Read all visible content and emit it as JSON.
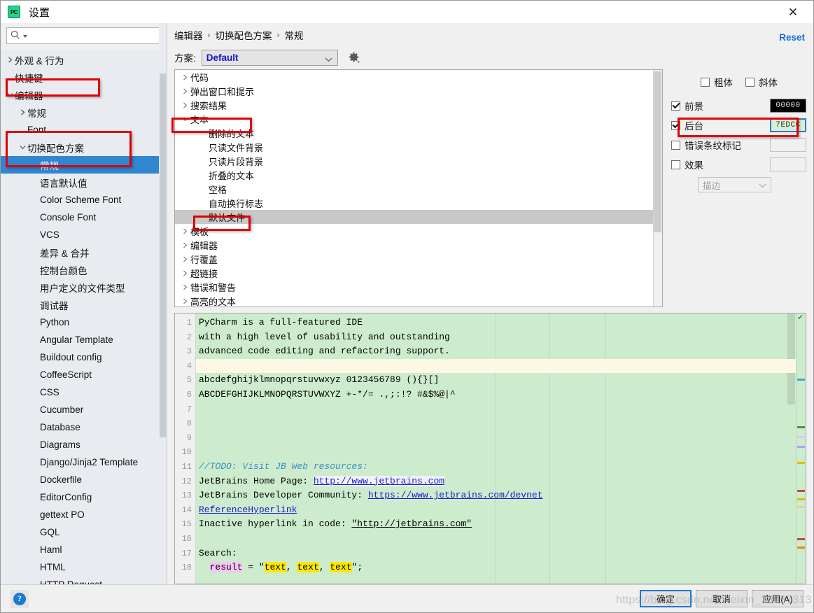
{
  "window": {
    "title": "设置",
    "app_icon": "pycharm-icon",
    "close_icon": "close-icon"
  },
  "sidebar": {
    "search": {
      "placeholder": "",
      "value": "",
      "icon": "search-icon"
    },
    "items": [
      {
        "label": "外观 & 行为",
        "indent": 0,
        "arrow": "right",
        "selected": false
      },
      {
        "label": "快捷键",
        "indent": 0,
        "arrow": "none",
        "selected": false
      },
      {
        "label": "编辑器",
        "indent": 0,
        "arrow": "down",
        "selected": false
      },
      {
        "label": "常规",
        "indent": 1,
        "arrow": "right",
        "selected": false
      },
      {
        "label": "Font",
        "indent": 1,
        "arrow": "none",
        "selected": false
      },
      {
        "label": "切换配色方案",
        "indent": 1,
        "arrow": "down",
        "selected": false
      },
      {
        "label": "常规",
        "indent": 2,
        "arrow": "none",
        "selected": true
      },
      {
        "label": "语言默认值",
        "indent": 2,
        "arrow": "none",
        "selected": false
      },
      {
        "label": "Color Scheme Font",
        "indent": 2,
        "arrow": "none",
        "selected": false
      },
      {
        "label": "Console Font",
        "indent": 2,
        "arrow": "none",
        "selected": false
      },
      {
        "label": "VCS",
        "indent": 2,
        "arrow": "none",
        "selected": false
      },
      {
        "label": "差异 & 合并",
        "indent": 2,
        "arrow": "none",
        "selected": false
      },
      {
        "label": "控制台颜色",
        "indent": 2,
        "arrow": "none",
        "selected": false
      },
      {
        "label": "用户定义的文件类型",
        "indent": 2,
        "arrow": "none",
        "selected": false
      },
      {
        "label": "调试器",
        "indent": 2,
        "arrow": "none",
        "selected": false
      },
      {
        "label": "Python",
        "indent": 2,
        "arrow": "none",
        "selected": false
      },
      {
        "label": "Angular Template",
        "indent": 2,
        "arrow": "none",
        "selected": false
      },
      {
        "label": "Buildout config",
        "indent": 2,
        "arrow": "none",
        "selected": false
      },
      {
        "label": "CoffeeScript",
        "indent": 2,
        "arrow": "none",
        "selected": false
      },
      {
        "label": "CSS",
        "indent": 2,
        "arrow": "none",
        "selected": false
      },
      {
        "label": "Cucumber",
        "indent": 2,
        "arrow": "none",
        "selected": false
      },
      {
        "label": "Database",
        "indent": 2,
        "arrow": "none",
        "selected": false
      },
      {
        "label": "Diagrams",
        "indent": 2,
        "arrow": "none",
        "selected": false
      },
      {
        "label": "Django/Jinja2 Template",
        "indent": 2,
        "arrow": "none",
        "selected": false
      },
      {
        "label": "Dockerfile",
        "indent": 2,
        "arrow": "none",
        "selected": false
      },
      {
        "label": "EditorConfig",
        "indent": 2,
        "arrow": "none",
        "selected": false
      },
      {
        "label": "gettext PO",
        "indent": 2,
        "arrow": "none",
        "selected": false
      },
      {
        "label": "GQL",
        "indent": 2,
        "arrow": "none",
        "selected": false
      },
      {
        "label": "Haml",
        "indent": 2,
        "arrow": "none",
        "selected": false
      },
      {
        "label": "HTML",
        "indent": 2,
        "arrow": "none",
        "selected": false
      },
      {
        "label": "HTTP Request",
        "indent": 2,
        "arrow": "none",
        "selected": false
      }
    ]
  },
  "header": {
    "breadcrumb": [
      "编辑器",
      "切换配色方案",
      "常规"
    ],
    "separator": "›",
    "reset_label": "Reset"
  },
  "scheme": {
    "label": "方案:",
    "value": "Default",
    "options": [
      "Default"
    ],
    "gear_icon": "gear-icon",
    "caret_icon": "chevron-down-icon"
  },
  "attribute_list": [
    {
      "label": "代码",
      "indent": 0,
      "arrow": "right",
      "selected": false
    },
    {
      "label": "弹出窗口和提示",
      "indent": 0,
      "arrow": "right",
      "selected": false
    },
    {
      "label": "搜索结果",
      "indent": 0,
      "arrow": "right",
      "selected": false
    },
    {
      "label": "文本",
      "indent": 0,
      "arrow": "down",
      "selected": false
    },
    {
      "label": "删除的文本",
      "indent": 1,
      "arrow": "none",
      "selected": false
    },
    {
      "label": "只读文件背景",
      "indent": 1,
      "arrow": "none",
      "selected": false
    },
    {
      "label": "只读片段背景",
      "indent": 1,
      "arrow": "none",
      "selected": false
    },
    {
      "label": "折叠的文本",
      "indent": 1,
      "arrow": "none",
      "selected": false
    },
    {
      "label": "空格",
      "indent": 1,
      "arrow": "none",
      "selected": false
    },
    {
      "label": "自动换行标志",
      "indent": 1,
      "arrow": "none",
      "selected": false
    },
    {
      "label": "默认文件",
      "indent": 1,
      "arrow": "none",
      "selected": true
    },
    {
      "label": "模板",
      "indent": 0,
      "arrow": "right",
      "selected": false
    },
    {
      "label": "编辑器",
      "indent": 0,
      "arrow": "right",
      "selected": false
    },
    {
      "label": "行覆盖",
      "indent": 0,
      "arrow": "right",
      "selected": false
    },
    {
      "label": "超链接",
      "indent": 0,
      "arrow": "right",
      "selected": false
    },
    {
      "label": "错误和警告",
      "indent": 0,
      "arrow": "right",
      "selected": false
    },
    {
      "label": "高亮的文本",
      "indent": 0,
      "arrow": "right",
      "selected": false
    }
  ],
  "attributes": {
    "bold": {
      "label": "粗体",
      "checked": false
    },
    "italic": {
      "label": "斜体",
      "checked": false
    },
    "foreground": {
      "label": "前景",
      "checked": true,
      "value": "00000",
      "color": "#000000"
    },
    "background": {
      "label": "后台",
      "checked": true,
      "value": "7EDCC",
      "color": "#d6f0d6"
    },
    "error_stripe": {
      "label": "错误条纹标记",
      "checked": false,
      "value": ""
    },
    "effects": {
      "label": "效果",
      "checked": false,
      "value": ""
    },
    "effect_type": {
      "value": "描边",
      "options": [
        "描边"
      ]
    }
  },
  "preview": {
    "lines": [
      {
        "n": "1",
        "text": "PyCharm is a full-featured IDE",
        "style": "plain"
      },
      {
        "n": "2",
        "text": "with a high level of usability and outstanding",
        "style": "plain"
      },
      {
        "n": "3",
        "text": "advanced code editing and refactoring support.",
        "style": "plain"
      },
      {
        "n": "4",
        "text": "",
        "style": "caret"
      },
      {
        "n": "5",
        "text": "abcdefghijklmnopqrstuvwxyz 0123456789 (){}[]",
        "style": "plain"
      },
      {
        "n": "6",
        "text": "ABCDEFGHIJKLMNOPQRSTUVWXYZ +-*/= .,;:!? #&$%@|^",
        "style": "plain"
      },
      {
        "n": "7",
        "text": "",
        "style": "plain"
      },
      {
        "n": "8",
        "text": "",
        "style": "plain"
      },
      {
        "n": "9",
        "text": "",
        "style": "plain"
      },
      {
        "n": "10",
        "text": "",
        "style": "plain"
      },
      {
        "n": "11",
        "text": "//TODO: Visit JB Web resources:",
        "style": "comment"
      },
      {
        "n": "12",
        "text": "JetBrains Home Page: ",
        "link": "http://www.jetbrains.com",
        "style": "link"
      },
      {
        "n": "13",
        "text": "JetBrains Developer Community: ",
        "link": "https://www.jetbrains.com/devnet",
        "style": "link2"
      },
      {
        "n": "14",
        "text": "",
        "link": "ReferenceHyperlink",
        "style": "link2"
      },
      {
        "n": "15",
        "text": "Inactive hyperlink in code: ",
        "link": "\"http://jetbrains.com\"",
        "style": "inactive"
      },
      {
        "n": "16",
        "text": "",
        "style": "plain"
      },
      {
        "n": "17",
        "text": "Search:",
        "style": "plain"
      },
      {
        "n": "18",
        "text": "  result = \"text, text, text\";",
        "style": "search"
      }
    ],
    "check_icon": "checkmark-ok-icon"
  },
  "footer": {
    "help_icon": "help-icon",
    "buttons": [
      {
        "label": "确定",
        "primary": true
      },
      {
        "label": "取消",
        "primary": false
      },
      {
        "label": "应用(A)",
        "primary": false
      }
    ]
  },
  "watermark": "https://blog.csdn.net/weixin_38957313"
}
